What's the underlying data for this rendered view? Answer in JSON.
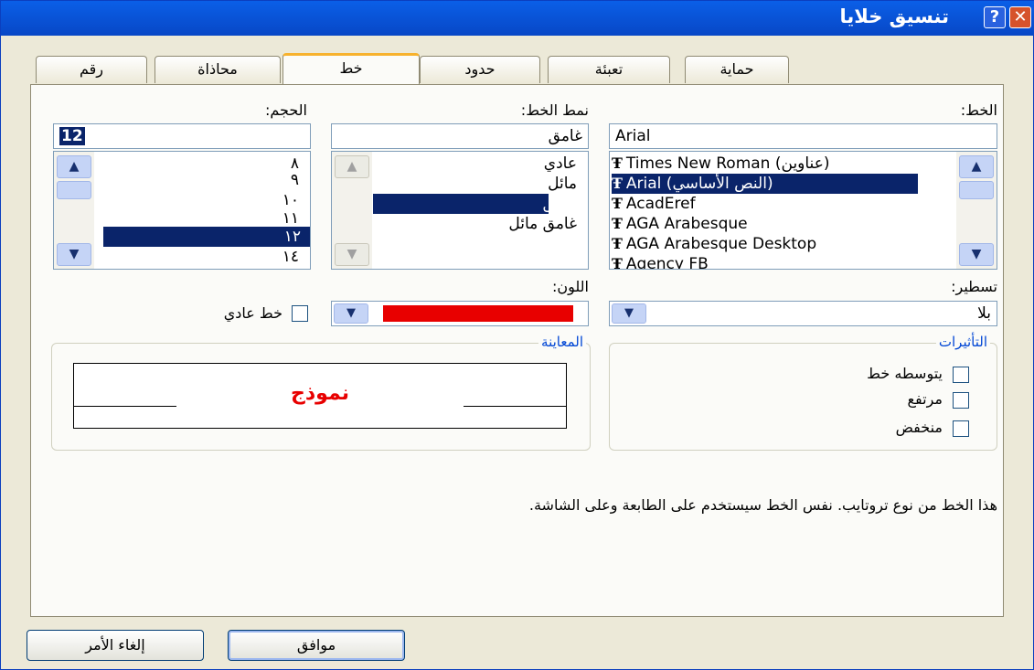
{
  "window": {
    "title": "تنسيق خلايا",
    "help_label": "?",
    "close_label": "✕"
  },
  "tabs": [
    {
      "label": "حماية"
    },
    {
      "label": "تعبئة"
    },
    {
      "label": "حدود"
    },
    {
      "label": "خط"
    },
    {
      "label": "محاذاة"
    },
    {
      "label": "رقم"
    }
  ],
  "active_tab": "خط",
  "font": {
    "label": "الخط:",
    "value": "Arial",
    "items": [
      "Times New Roman (عناوين)",
      "Arial (النص الأساسي)",
      "AcadEref",
      "AGA Arabesque",
      "AGA Arabesque Desktop",
      "Agency FB"
    ],
    "selected": "Arial (النص الأساسي)",
    "truetype_glyph": "Ŧ"
  },
  "style": {
    "label": "نمط الخط:",
    "value": "غامق",
    "items": [
      "عادي",
      "مائل",
      "غامق",
      "غامق مائل"
    ],
    "selected": "غامق"
  },
  "size": {
    "label": "الحجم:",
    "value": "12",
    "items": [
      "٨",
      "٩",
      "١٠",
      "١١",
      "١٢",
      "١٤"
    ],
    "selected": "١٢"
  },
  "underline": {
    "label": "تسطير:",
    "value": "بلا"
  },
  "color": {
    "label": "اللون:",
    "value": "#e80000"
  },
  "normal_font": {
    "label": "خط عادي",
    "checked": false
  },
  "effects": {
    "title": "التأثيرات",
    "items": [
      {
        "label": "يتوسطه خط",
        "checked": false
      },
      {
        "label": "مرتفع",
        "checked": false
      },
      {
        "label": "منخفض",
        "checked": false
      }
    ]
  },
  "preview": {
    "title": "المعاينة",
    "sample": "نموذج"
  },
  "description": "هذا الخط من نوع تروتايب. نفس الخط سيستخدم على الطابعة وعلى الشاشة.",
  "buttons": {
    "ok": "موافق",
    "cancel": "إلغاء الأمر"
  },
  "colors": {
    "accent": "#0a246a",
    "title_bar": "#0a5fe7",
    "active_tab_border": "#f7b22e",
    "sample_text": "#e80000"
  }
}
